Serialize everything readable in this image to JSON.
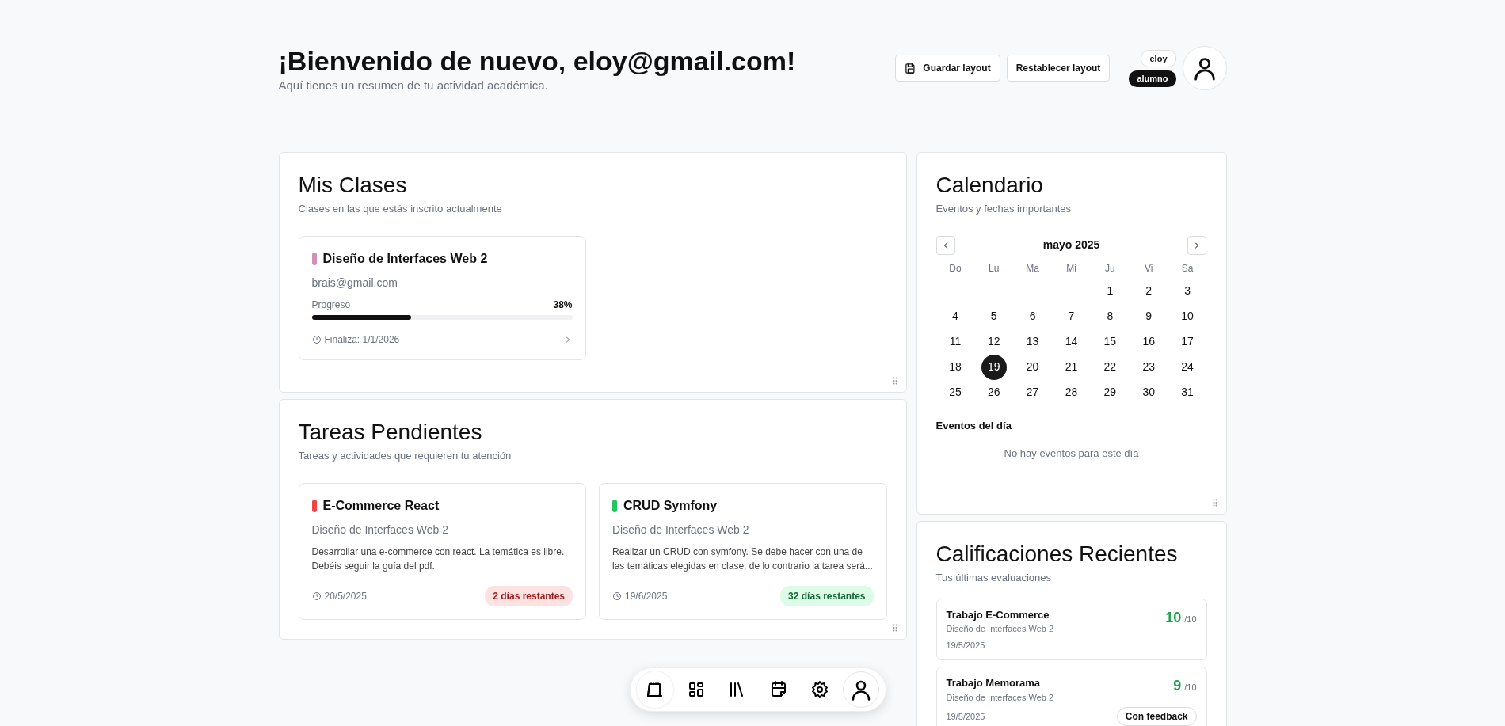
{
  "header": {
    "title": "¡Bienvenido de nuevo, eloy@gmail.com!",
    "subtitle": "Aquí tienes un resumen de tu actividad académica.",
    "buttons": [
      {
        "label": "Guardar layout",
        "kind": "save"
      },
      {
        "label": "Restablecer layout",
        "kind": "plain"
      }
    ],
    "user": {
      "name": "eloy",
      "role": "alumno"
    }
  },
  "classes": {
    "title": "Mis Clases",
    "subtitle": "Clases en las que estás inscrito actualmente",
    "items": [
      {
        "name": "Diseño de Interfaces Web 2",
        "color": "#d48fb4",
        "teacher": "brais@gmail.com",
        "progress_label": "Progreso",
        "progress_text": "38%",
        "level": 0.38,
        "end": "Finaliza: 1/1/2026"
      }
    ]
  },
  "tasks": {
    "title": "Tareas Pendientes",
    "subtitle": "Tareas y actividades que requieren tu atención",
    "items": [
      {
        "title": "E-Commerce React",
        "color": "#ef4444",
        "course": "Diseño de Interfaces Web 2",
        "description": "Desarrollar una e-commerce con react. La temática es libre. Debéis seguir la guía del pdf.",
        "date": "20/5/2025",
        "remaining": "2 días restantes",
        "urgent": true
      },
      {
        "title": "CRUD Symfony",
        "color": "#22c55e",
        "course": "Diseño de Interfaces Web 2",
        "description": "Realizar un CRUD con symfony. Se debe hacer con una de las temáticas elegidas en clase, de lo contrario la tarea será...",
        "date": "19/6/2025",
        "remaining": "32 días restantes",
        "urgent": false
      }
    ]
  },
  "calendar": {
    "title": "Calendario",
    "subtitle": "Eventos y fechas importantes",
    "month": "mayo 2025",
    "weekdays": [
      "Do",
      "Lu",
      "Ma",
      "Mi",
      "Ju",
      "Vi",
      "Sa"
    ],
    "weeks": [
      [
        {
          "day": "1",
          "selected": false
        },
        {
          "day": "2",
          "selected": false
        },
        {
          "day": "3",
          "selected": false
        }
      ],
      [
        {
          "day": "4",
          "selected": false
        },
        {
          "day": "5",
          "selected": false
        },
        {
          "day": "6",
          "selected": false
        },
        {
          "day": "7",
          "selected": false
        },
        {
          "day": "8",
          "selected": false
        },
        {
          "day": "9",
          "selected": false
        },
        {
          "day": "10",
          "selected": false
        }
      ],
      [
        {
          "day": "11",
          "selected": false
        },
        {
          "day": "12",
          "selected": false
        },
        {
          "day": "13",
          "selected": false
        },
        {
          "day": "14",
          "selected": false
        },
        {
          "day": "15",
          "selected": false
        },
        {
          "day": "16",
          "selected": false
        },
        {
          "day": "17",
          "selected": false
        }
      ],
      [
        {
          "day": "18",
          "selected": false
        },
        {
          "day": "19",
          "selected": true
        },
        {
          "day": "20",
          "selected": false
        },
        {
          "day": "21",
          "selected": false
        },
        {
          "day": "22",
          "selected": false
        },
        {
          "day": "23",
          "selected": false
        },
        {
          "day": "24",
          "selected": false
        }
      ],
      [
        {
          "day": "25",
          "selected": false
        },
        {
          "day": "26",
          "selected": false
        },
        {
          "day": "27",
          "selected": false
        },
        {
          "day": "28",
          "selected": false
        },
        {
          "day": "29",
          "selected": false
        },
        {
          "day": "30",
          "selected": false
        },
        {
          "day": "31",
          "selected": false
        }
      ]
    ],
    "events_title": "Eventos del día",
    "empty_text": "No hay eventos para este día"
  },
  "grades": {
    "title": "Calificaciones Recientes",
    "subtitle": "Tus últimas evaluaciones",
    "items": [
      {
        "title": "Trabajo E-Commerce",
        "course": "Diseño de Interfaces Web 2",
        "date": "19/5/2025",
        "score": "10",
        "out_of": "/10"
      },
      {
        "title": "Trabajo Memorama",
        "course": "Diseño de Interfaces Web 2",
        "date": "19/5/2025",
        "score": "9",
        "out_of": "/10",
        "tag": "Con feedback"
      }
    ]
  },
  "dock": [
    {
      "kind": "notepad",
      "selected": true
    },
    {
      "kind": "dashboard",
      "selected": false
    },
    {
      "kind": "library",
      "selected": false
    },
    {
      "kind": "calendar",
      "selected": false
    },
    {
      "kind": "settings",
      "selected": false
    },
    {
      "kind": "avatar",
      "selected": false
    }
  ]
}
